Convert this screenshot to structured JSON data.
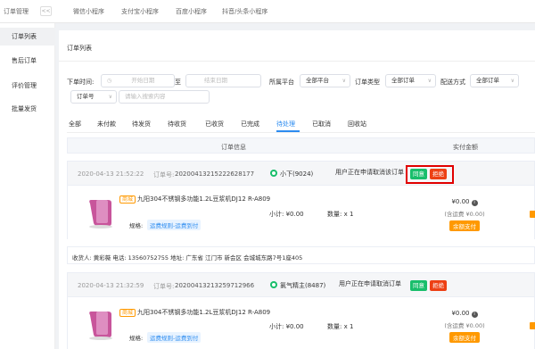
{
  "app": {
    "title": "订单管理",
    "collapse_icon": "double-chevron-left-icon",
    "collapse_glyph": "<<"
  },
  "platform_tabs": [
    "微信小程序",
    "支付宝小程序",
    "百度小程序",
    "抖音/头条小程序"
  ],
  "sidebar": {
    "items": [
      {
        "label": "订单列表",
        "active": true
      },
      {
        "label": "售后订单",
        "active": false
      },
      {
        "label": "评价管理",
        "active": false
      },
      {
        "label": "批量发货",
        "active": false
      }
    ]
  },
  "page": {
    "title": "订单列表"
  },
  "filters": {
    "order_time_label": "下单时间:",
    "start_placeholder": "开始日期",
    "range_sep": "至",
    "end_placeholder": "结束日期",
    "platform_label": "所属平台",
    "platform_value": "全部平台",
    "type_label": "订单类型",
    "type_value": "全部订单",
    "delivery_label": "配送方式",
    "delivery_value": "全部订单",
    "search_field_value": "订单号",
    "search_placeholder": "请输入搜索内容",
    "chevron_glyph": "∨",
    "calendar_icon": "calendar-icon"
  },
  "tabs": [
    "全部",
    "未付款",
    "待发货",
    "待收货",
    "已收货",
    "已完成",
    "待处理",
    "已取消",
    "回收站"
  ],
  "active_tab": "待处理",
  "table": {
    "headers": [
      "订单信息",
      "实付金额"
    ]
  },
  "orders": [
    {
      "time": "2020-04-13 21:52:22",
      "order_no_label": "订单号:",
      "order_no": "20200413215222628177",
      "store": "小下(9024)",
      "notice": "用户正在申请取消该订单",
      "agree_label": "同意",
      "reject_label": "拒绝",
      "highlighted": true,
      "goods": {
        "tag": "商城",
        "name": "九阳304不锈钢多功能1.2L豆浆机DJ12 R-A809",
        "spec_label": "规格:",
        "spec_value": "运费规则-运费到付",
        "subtotal": "小计: ¥0.00",
        "qty": "数量: x 1"
      },
      "payment": {
        "amount": "¥0.00",
        "freight": "(含运费 ¥0.00)",
        "method": "余额支付"
      },
      "address": "收货人: 黄彩薇 电话: 13560752755 地址: 广东省 江门市 新会区 会城城东路7号1座405"
    },
    {
      "time": "2020-04-13 21:32:59",
      "order_no_label": "订单号:",
      "order_no": "20200413213259712966",
      "store": "氯气精主(8487)",
      "notice": "用户正在申请取消订单",
      "agree_label": "同意",
      "reject_label": "拒绝",
      "highlighted": false,
      "goods": {
        "tag": "商城",
        "name": "九阳304不锈钢多功能1.2L豆浆机DJ12 R-A809",
        "spec_label": "规格:",
        "spec_value": "运费规则-运费到付",
        "subtotal": "小计: ¥0.00",
        "qty": "数量: x 1"
      },
      "payment": {
        "amount": "¥0.00",
        "freight": "(含运费 ¥0.00)",
        "method": "余额支付"
      }
    }
  ],
  "colors": {
    "primary": "#2d8cf0",
    "agree": "#19be6b",
    "reject": "#ed4014",
    "highlight_frame": "#e10000",
    "balance_pay": "#ff9900",
    "product_pink": "#c8559b"
  },
  "icons": {
    "store": "wechat-store-icon",
    "info": "info-icon",
    "product": "soymilk-maker-thumbnail",
    "row_action": "orange-action-icon"
  }
}
